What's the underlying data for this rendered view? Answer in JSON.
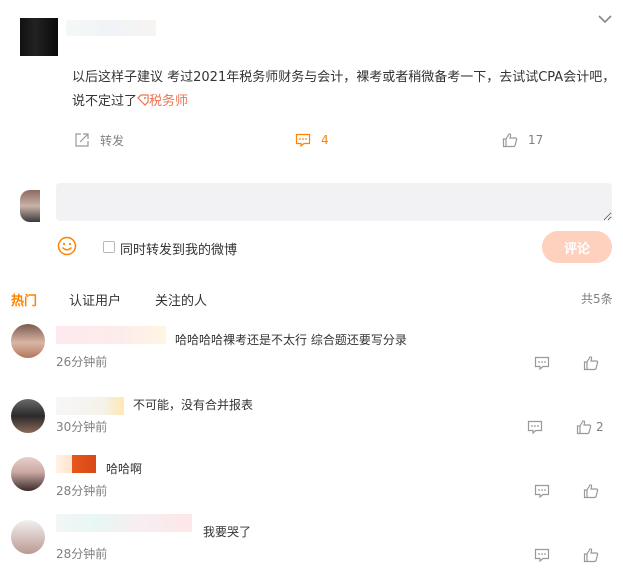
{
  "post": {
    "text": "以后这样子建议 考过2021年税务师财务与会计，裸考或者稍微备考一下，去试试CPA会计吧，说不定过了",
    "tag": "税务师",
    "actions": {
      "share_label": "转发",
      "comment_count": "4",
      "like_count": "17"
    }
  },
  "composer": {
    "placeholder": "",
    "repost_label": "同时转发到我的微博",
    "submit_label": "评论"
  },
  "tabs": {
    "hot": "热门",
    "verified": "认证用户",
    "following": "关注的人",
    "total": "共5条"
  },
  "comments": [
    {
      "text": "哈哈哈哈裸考还是不太行 综合题还要写分录",
      "time": "26分钟前",
      "likes": ""
    },
    {
      "text": "不可能，没有合并报表",
      "time": "30分钟前",
      "likes": "2"
    },
    {
      "text": "哈哈啊",
      "time": "28分钟前",
      "likes": ""
    },
    {
      "text": "我要哭了",
      "time": "28分钟前",
      "likes": ""
    }
  ],
  "colors": {
    "accent": "#ff8200",
    "tag": "#eb7350",
    "submit_disabled": "#fdd1bd"
  }
}
